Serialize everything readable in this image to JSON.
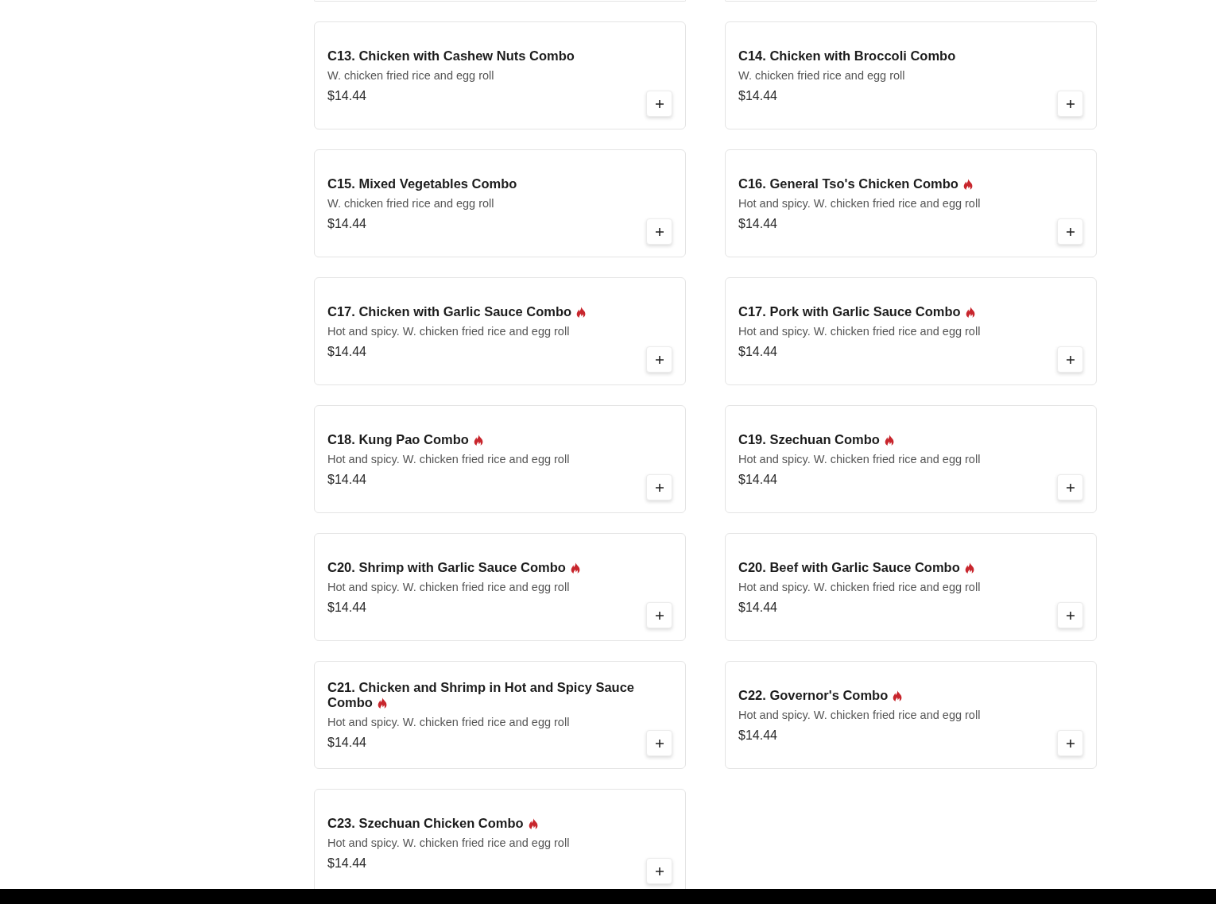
{
  "items": [
    {
      "name": "C13. Chicken with Cashew Nuts Combo",
      "description": "W. chicken fried rice and egg roll",
      "price": "$14.44",
      "spicy": false
    },
    {
      "name": "C14. Chicken with Broccoli Combo",
      "description": "W. chicken fried rice and egg roll",
      "price": "$14.44",
      "spicy": false
    },
    {
      "name": "C15. Mixed Vegetables Combo",
      "description": "W. chicken fried rice and egg roll",
      "price": "$14.44",
      "spicy": false
    },
    {
      "name": "C16. General Tso's Chicken Combo",
      "description": "Hot and spicy. W. chicken fried rice and egg roll",
      "price": "$14.44",
      "spicy": true
    },
    {
      "name": "C17. Chicken with Garlic Sauce Combo",
      "description": "Hot and spicy. W. chicken fried rice and egg roll",
      "price": "$14.44",
      "spicy": true
    },
    {
      "name": "C17. Pork with Garlic Sauce Combo",
      "description": "Hot and spicy. W. chicken fried rice and egg roll",
      "price": "$14.44",
      "spicy": true
    },
    {
      "name": "C18. Kung Pao Combo",
      "description": "Hot and spicy. W. chicken fried rice and egg roll",
      "price": "$14.44",
      "spicy": true
    },
    {
      "name": "C19. Szechuan Combo",
      "description": "Hot and spicy. W. chicken fried rice and egg roll",
      "price": "$14.44",
      "spicy": true
    },
    {
      "name": "C20. Shrimp with Garlic Sauce Combo",
      "description": "Hot and spicy. W. chicken fried rice and egg roll",
      "price": "$14.44",
      "spicy": true
    },
    {
      "name": "C20. Beef with Garlic Sauce Combo",
      "description": "Hot and spicy. W. chicken fried rice and egg roll",
      "price": "$14.44",
      "spicy": true
    },
    {
      "name": "C21. Chicken and Shrimp in Hot and Spicy Sauce Combo",
      "description": "Hot and spicy. W. chicken fried rice and egg roll",
      "price": "$14.44",
      "spicy": true
    },
    {
      "name": "C22. Governor's Combo",
      "description": "Hot and spicy. W. chicken fried rice and egg roll",
      "price": "$14.44",
      "spicy": true
    },
    {
      "name": "C23. Szechuan Chicken Combo",
      "description": "Hot and spicy. W. chicken fried rice and egg roll",
      "price": "$14.44",
      "spicy": true
    }
  ]
}
